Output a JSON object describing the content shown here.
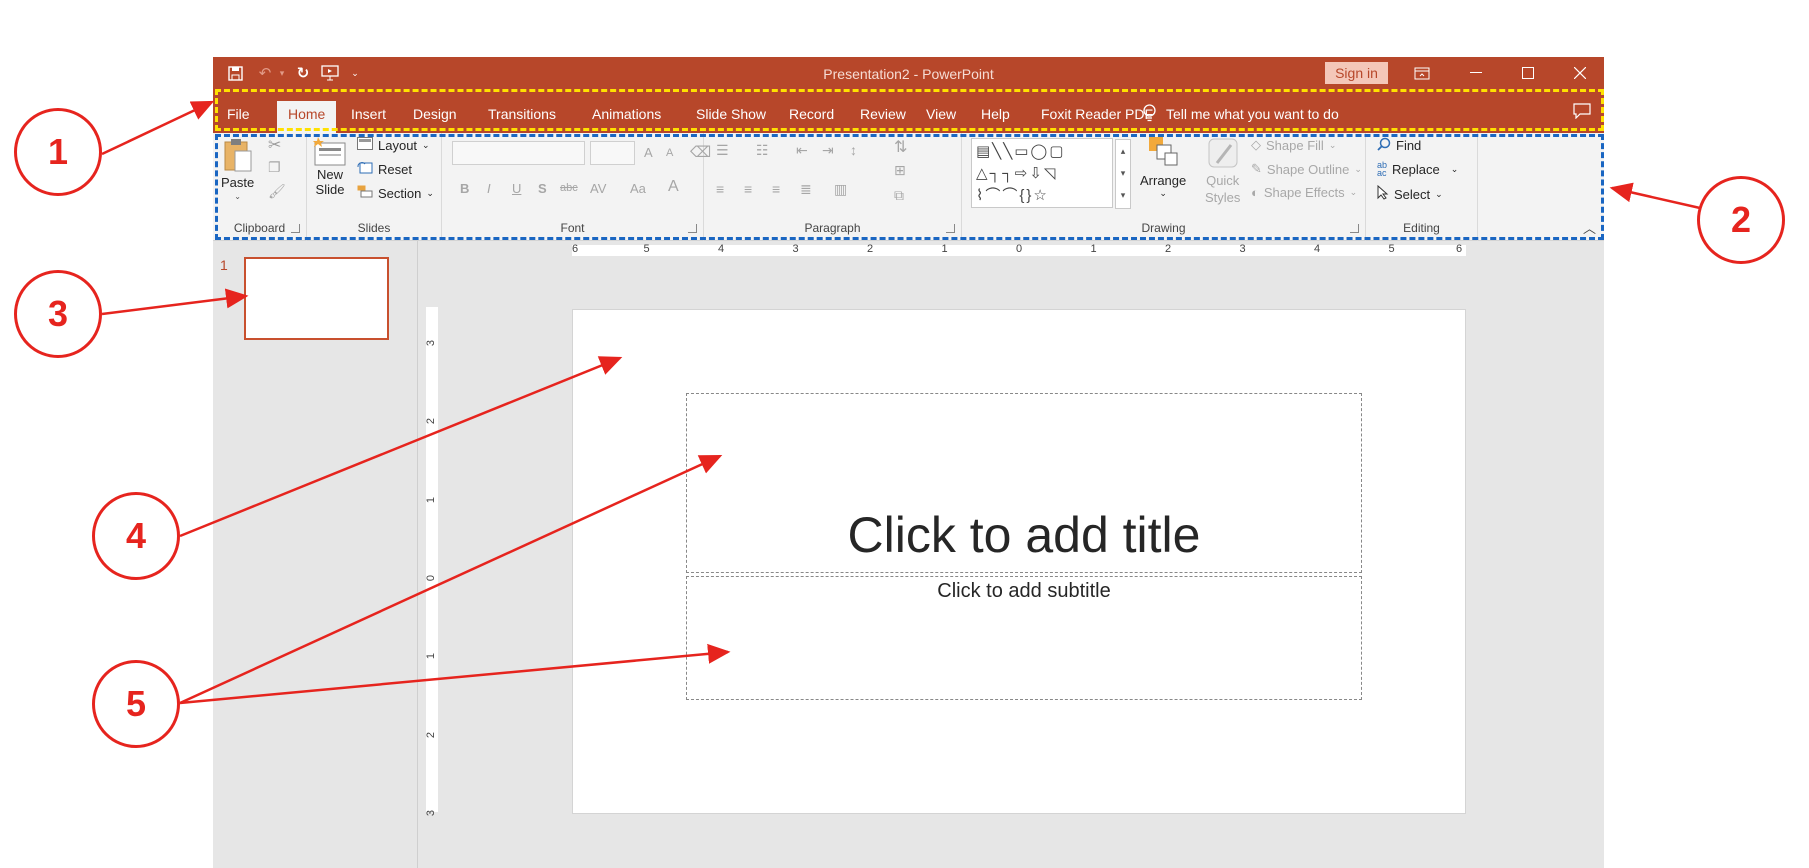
{
  "window": {
    "title": "Presentation2  -  PowerPoint",
    "sign_in": "Sign in"
  },
  "tabs": [
    {
      "label": "File"
    },
    {
      "label": "Home",
      "active": true
    },
    {
      "label": "Insert"
    },
    {
      "label": "Design"
    },
    {
      "label": "Transitions"
    },
    {
      "label": "Animations"
    },
    {
      "label": "Slide Show"
    },
    {
      "label": "Record"
    },
    {
      "label": "Review"
    },
    {
      "label": "View"
    },
    {
      "label": "Help"
    },
    {
      "label": "Foxit Reader PDF"
    }
  ],
  "tell_me": "Tell me what you want to do",
  "ribbon": {
    "clipboard": {
      "label": "Clipboard",
      "paste": "Paste"
    },
    "slides": {
      "label": "Slides",
      "new_slide_line1": "New",
      "new_slide_line2": "Slide",
      "layout": "Layout",
      "reset": "Reset",
      "section": "Section"
    },
    "font": {
      "label": "Font",
      "bold": "B",
      "italic": "I",
      "underline": "U",
      "shadow": "S",
      "strike": "abc",
      "spacing": "AV",
      "case": "Aa",
      "color": "A",
      "grow": "A",
      "shrink": "A"
    },
    "paragraph": {
      "label": "Paragraph"
    },
    "drawing": {
      "label": "Drawing",
      "arrange": "Arrange",
      "quick_styles_line1": "Quick",
      "quick_styles_line2": "Styles",
      "shape_fill": "Shape Fill",
      "shape_outline": "Shape Outline",
      "shape_effects": "Shape Effects"
    },
    "editing": {
      "label": "Editing",
      "find": "Find",
      "replace": "Replace",
      "select": "Select"
    }
  },
  "thumbnails": [
    {
      "number": "1"
    }
  ],
  "slide": {
    "title_placeholder": "Click to add title",
    "subtitle_placeholder": "Click to add subtitle"
  },
  "rulers": {
    "horizontal_ticks": [
      "6",
      "5",
      "4",
      "3",
      "2",
      "1",
      "0",
      "1",
      "2",
      "3",
      "4",
      "5",
      "6"
    ],
    "vertical_ticks": [
      "3",
      "2",
      "1",
      "0",
      "1",
      "2",
      "3"
    ]
  },
  "callouts": [
    "1",
    "2",
    "3",
    "4",
    "5"
  ],
  "colors": {
    "brand": "#b7472a",
    "tab_highlight": "#ffe100",
    "ribbon_highlight": "#1a66c2",
    "annotation": "#e6241e"
  }
}
